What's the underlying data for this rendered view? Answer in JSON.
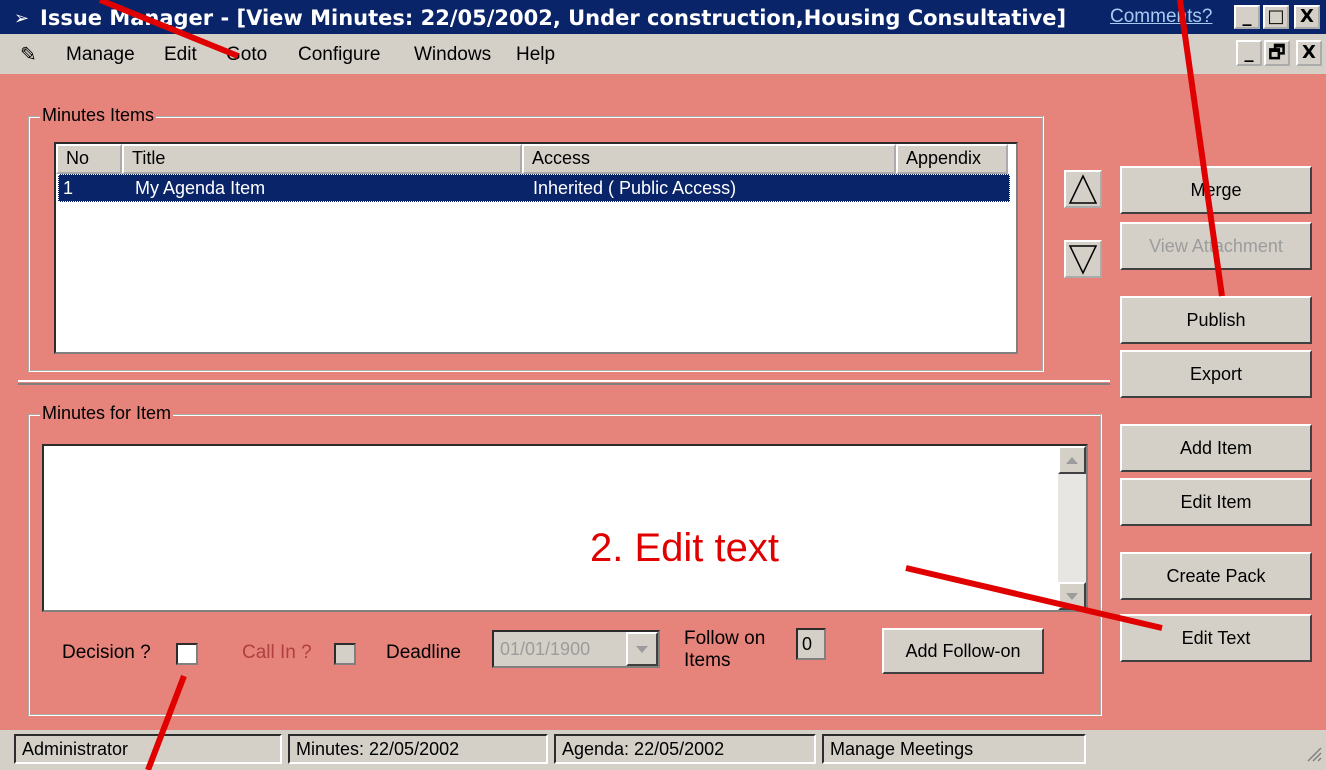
{
  "window": {
    "title": "Issue Manager - [View Minutes: 22/05/2002, Under construction,Housing Consultative]",
    "comments_link": "Comments?",
    "controls": [
      "_",
      "□",
      "X"
    ]
  },
  "menubar": {
    "items": [
      "Manage",
      "Edit",
      "Goto",
      "Configure",
      "Windows",
      "Help"
    ],
    "mdi_controls": [
      "_",
      "🗗",
      "X"
    ]
  },
  "minutes_items": {
    "legend": "Minutes Items",
    "columns": [
      "No",
      "Title",
      "Access",
      "Appendix"
    ],
    "rows": [
      {
        "no": "1",
        "title": "My Agenda Item",
        "access": "Inherited ( Public Access)",
        "appendix": ""
      }
    ]
  },
  "minutes_for_item": {
    "legend": "Minutes for Item",
    "decision_label": "Decision ?",
    "call_in_label": "Call In ?",
    "deadline_label": "Deadline",
    "deadline_value": "01/01/1900",
    "follow_on_label": "Follow on Items",
    "follow_on_count": "0",
    "add_follow_on": "Add Follow-on"
  },
  "side_buttons": {
    "merge": "Merge",
    "view_attachment": "View Attachment",
    "publish": "Publish",
    "export": "Export",
    "add_item": "Add Item",
    "edit_item": "Edit Item",
    "create_pack": "Create Pack",
    "edit_text": "Edit Text"
  },
  "statusbar": {
    "user": "Administrator",
    "minutes": "Minutes: 22/05/2002",
    "agenda": "Agenda: 22/05/2002",
    "mode": "Manage Meetings"
  },
  "annotation": {
    "text": "2. Edit text",
    "color": "#E00000"
  },
  "colors": {
    "title_bar": "#0A246A",
    "window_bg": "#E6837B",
    "chrome": "#D4D0C8",
    "selection": "#0A246A"
  }
}
